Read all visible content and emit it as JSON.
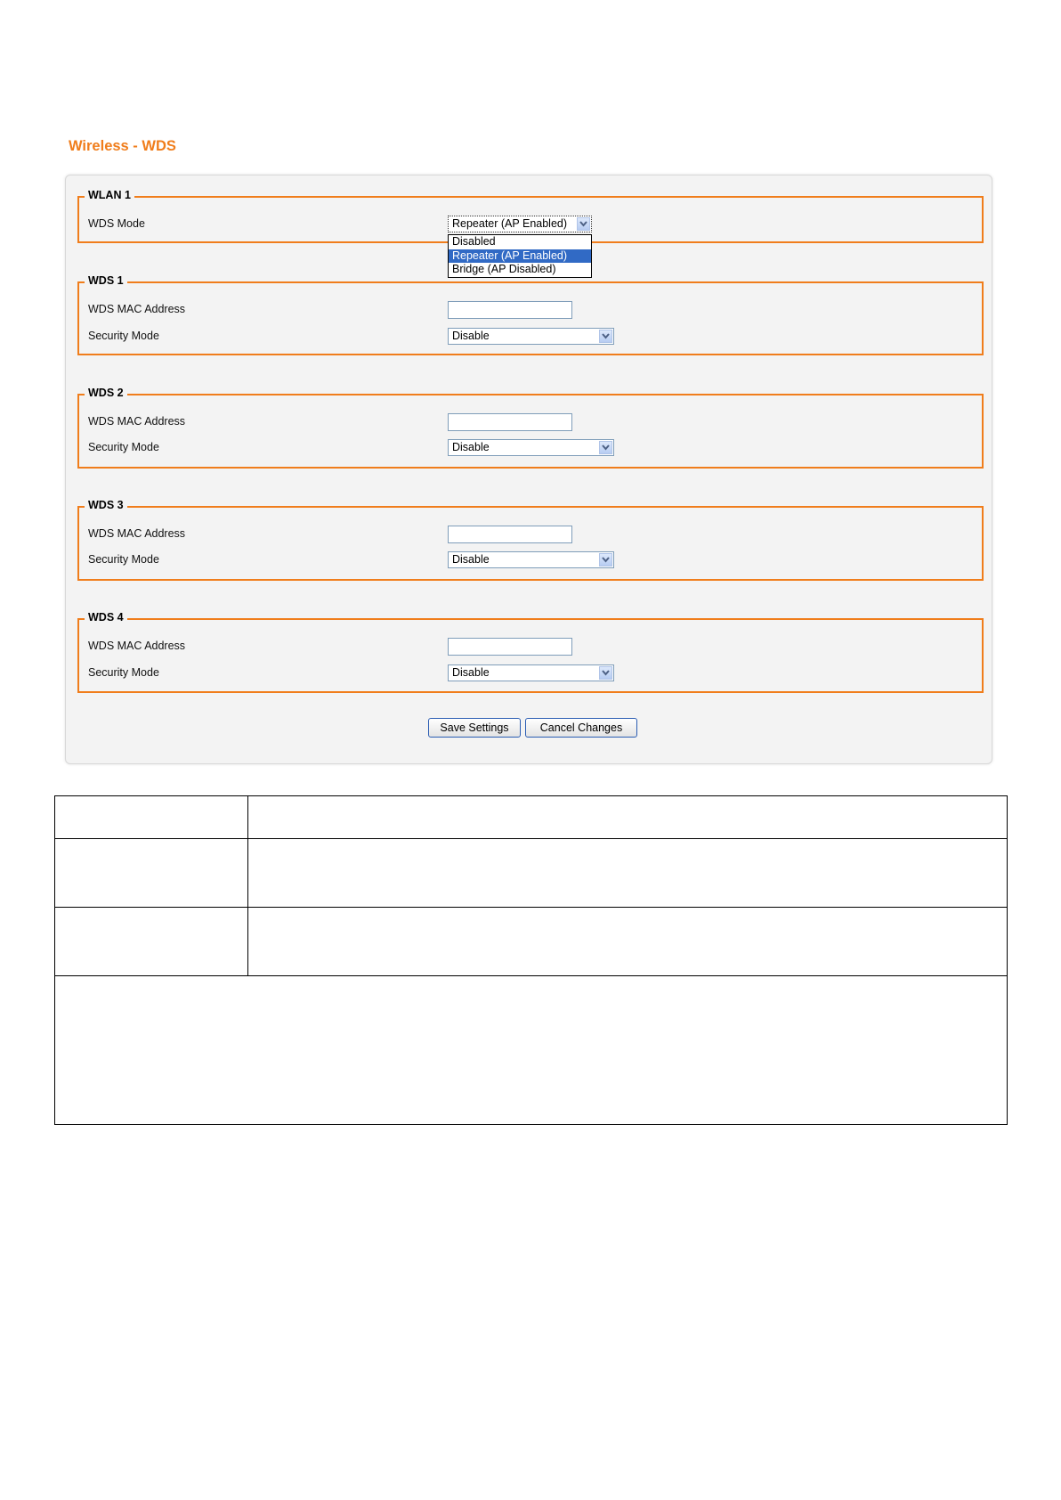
{
  "page": {
    "title": "Wireless - WDS"
  },
  "wlan1": {
    "legend": "WLAN 1",
    "wds_mode_label": "WDS Mode",
    "wds_mode_value": "Repeater (AP Enabled)",
    "wds_mode_options": [
      "Disabled",
      "Repeater (AP Enabled)",
      "Bridge (AP Disabled)"
    ],
    "highlighted_option": "Repeater (AP Enabled)"
  },
  "wds_sections": [
    {
      "legend": "WDS 1",
      "mac_label": "WDS MAC Address",
      "mac_value": "",
      "security_label": "Security Mode",
      "security_value": "Disable"
    },
    {
      "legend": "WDS 2",
      "mac_label": "WDS MAC Address",
      "mac_value": "",
      "security_label": "Security Mode",
      "security_value": "Disable"
    },
    {
      "legend": "WDS 3",
      "mac_label": "WDS MAC Address",
      "mac_value": "",
      "security_label": "Security Mode",
      "security_value": "Disable"
    },
    {
      "legend": "WDS 4",
      "mac_label": "WDS MAC Address",
      "mac_value": "",
      "security_label": "Security Mode",
      "security_value": "Disable"
    }
  ],
  "buttons": {
    "save": "Save Settings",
    "cancel": "Cancel Changes"
  },
  "colors": {
    "accent": "#f07d1b",
    "selection": "#316ac5"
  }
}
